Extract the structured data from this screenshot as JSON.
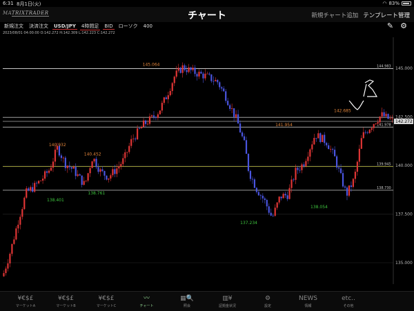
{
  "status": {
    "time": "6:31",
    "date": "8月1日(火)",
    "battery": "83%"
  },
  "nav": {
    "logo_prefix": "MA",
    "logo_rest": "TRIXTRADER",
    "title": "チャート",
    "add_label": "新規チャート追加",
    "template_label": "テンプレート管理"
  },
  "toolbar": {
    "new_order": "新規注文",
    "settle_order": "決済注文",
    "pair": "USD/JPY",
    "period": "4時間足",
    "bid": "BID",
    "candle": "ローソク",
    "count": "400"
  },
  "tools": {
    "pen_icon": "pencil-icon",
    "settings_icon": "gear-icon"
  },
  "ohlc_text": "2023/08/01 04:00:00  O:142.272  H:142.309  L:142.223  C:142.272",
  "chart_data": {
    "type": "candlestick",
    "ylim": [
      133.9,
      146.6
    ],
    "y_ticks": [
      "145.000",
      "142.500",
      "140.000",
      "137.500",
      "135.000"
    ],
    "y_tick_values": [
      145.0,
      142.5,
      140.0,
      137.5,
      135.0
    ],
    "horizontal_lines": [
      {
        "value": 144.983,
        "label": "144.983",
        "color": "#dddddd"
      },
      {
        "value": 142.475,
        "label": "",
        "color": "#bbbbbb"
      },
      {
        "value": 142.272,
        "label": "142.272",
        "color": "#ffffff",
        "current": true
      },
      {
        "value": 141.978,
        "label": "141.978",
        "color": "#bbbbbb"
      },
      {
        "value": 139.945,
        "label": "139.945",
        "color": "#c9c94a"
      },
      {
        "value": 138.73,
        "label": "138.730",
        "color": "#cccccc"
      }
    ],
    "annotations": [
      {
        "text": "145.064",
        "value": 145.064,
        "kind": "high",
        "pos": 0.38
      },
      {
        "text": "140.932",
        "value": 140.932,
        "kind": "high",
        "pos": 0.14
      },
      {
        "text": "140.452",
        "value": 140.452,
        "kind": "high",
        "pos": 0.23
      },
      {
        "text": "141.954",
        "value": 141.954,
        "kind": "high",
        "pos": 0.72
      },
      {
        "text": "142.685",
        "value": 142.685,
        "kind": "high",
        "pos": 0.87
      },
      {
        "text": "138.401",
        "value": 138.401,
        "kind": "low",
        "pos": 0.135
      },
      {
        "text": "138.761",
        "value": 138.761,
        "kind": "low",
        "pos": 0.24
      },
      {
        "text": "137.234",
        "value": 137.234,
        "kind": "low",
        "pos": 0.63
      },
      {
        "text": "138.054",
        "value": 138.054,
        "kind": "low",
        "pos": 0.81
      }
    ],
    "colors": {
      "up": "#e03535",
      "down": "#4a55e0",
      "high_label": "#e0843a",
      "low_label": "#3ec43e"
    },
    "path": [
      [
        0.0,
        134.3
      ],
      [
        0.02,
        135.6
      ],
      [
        0.04,
        137.2
      ],
      [
        0.06,
        138.6
      ],
      [
        0.08,
        138.9
      ],
      [
        0.1,
        139.3
      ],
      [
        0.12,
        139.8
      ],
      [
        0.14,
        140.93
      ],
      [
        0.16,
        140.1
      ],
      [
        0.18,
        139.8
      ],
      [
        0.21,
        139.0
      ],
      [
        0.23,
        140.45
      ],
      [
        0.25,
        139.7
      ],
      [
        0.27,
        139.4
      ],
      [
        0.29,
        139.8
      ],
      [
        0.31,
        140.3
      ],
      [
        0.33,
        141.3
      ],
      [
        0.36,
        142.1
      ],
      [
        0.38,
        142.4
      ],
      [
        0.4,
        142.8
      ],
      [
        0.42,
        143.6
      ],
      [
        0.44,
        144.6
      ],
      [
        0.46,
        145.06
      ],
      [
        0.49,
        144.8
      ],
      [
        0.52,
        144.6
      ],
      [
        0.55,
        144.3
      ],
      [
        0.57,
        143.6
      ],
      [
        0.6,
        142.3
      ],
      [
        0.62,
        141.0
      ],
      [
        0.63,
        139.7
      ],
      [
        0.65,
        138.8
      ],
      [
        0.67,
        138.2
      ],
      [
        0.69,
        137.3
      ],
      [
        0.71,
        138.4
      ],
      [
        0.73,
        138.5
      ],
      [
        0.75,
        139.7
      ],
      [
        0.77,
        140.1
      ],
      [
        0.8,
        141.6
      ],
      [
        0.83,
        141.2
      ],
      [
        0.85,
        140.4
      ],
      [
        0.88,
        138.5
      ],
      [
        0.9,
        139.3
      ],
      [
        0.92,
        141.5
      ],
      [
        0.95,
        142.2
      ],
      [
        0.97,
        142.6
      ],
      [
        1.0,
        142.27
      ]
    ],
    "handwriting_icon": "handwritten-mark-icon"
  },
  "bottom_tabs": [
    {
      "icon_text": "¥€$£",
      "label": "マーケットA",
      "icon": "market-icon"
    },
    {
      "icon_text": "¥€$£",
      "label": "マーケットB",
      "icon": "market-icon"
    },
    {
      "icon_text": "¥€$£",
      "label": "マーケットC",
      "icon": "market-icon"
    },
    {
      "icon_text": "〰",
      "label": "チャート",
      "icon": "chart-icon",
      "active": true
    },
    {
      "icon_text": "▦🔍",
      "label": "照会",
      "icon": "search-icon"
    },
    {
      "icon_text": "▥¥",
      "label": "証拠金状況",
      "icon": "margin-icon"
    },
    {
      "icon_text": "⚙",
      "label": "設定",
      "icon": "settings-icon"
    },
    {
      "icon_text": "NEWS",
      "label": "情報",
      "icon": "news-icon"
    },
    {
      "icon_text": "etc..",
      "label": "その他",
      "icon": "more-icon"
    }
  ]
}
